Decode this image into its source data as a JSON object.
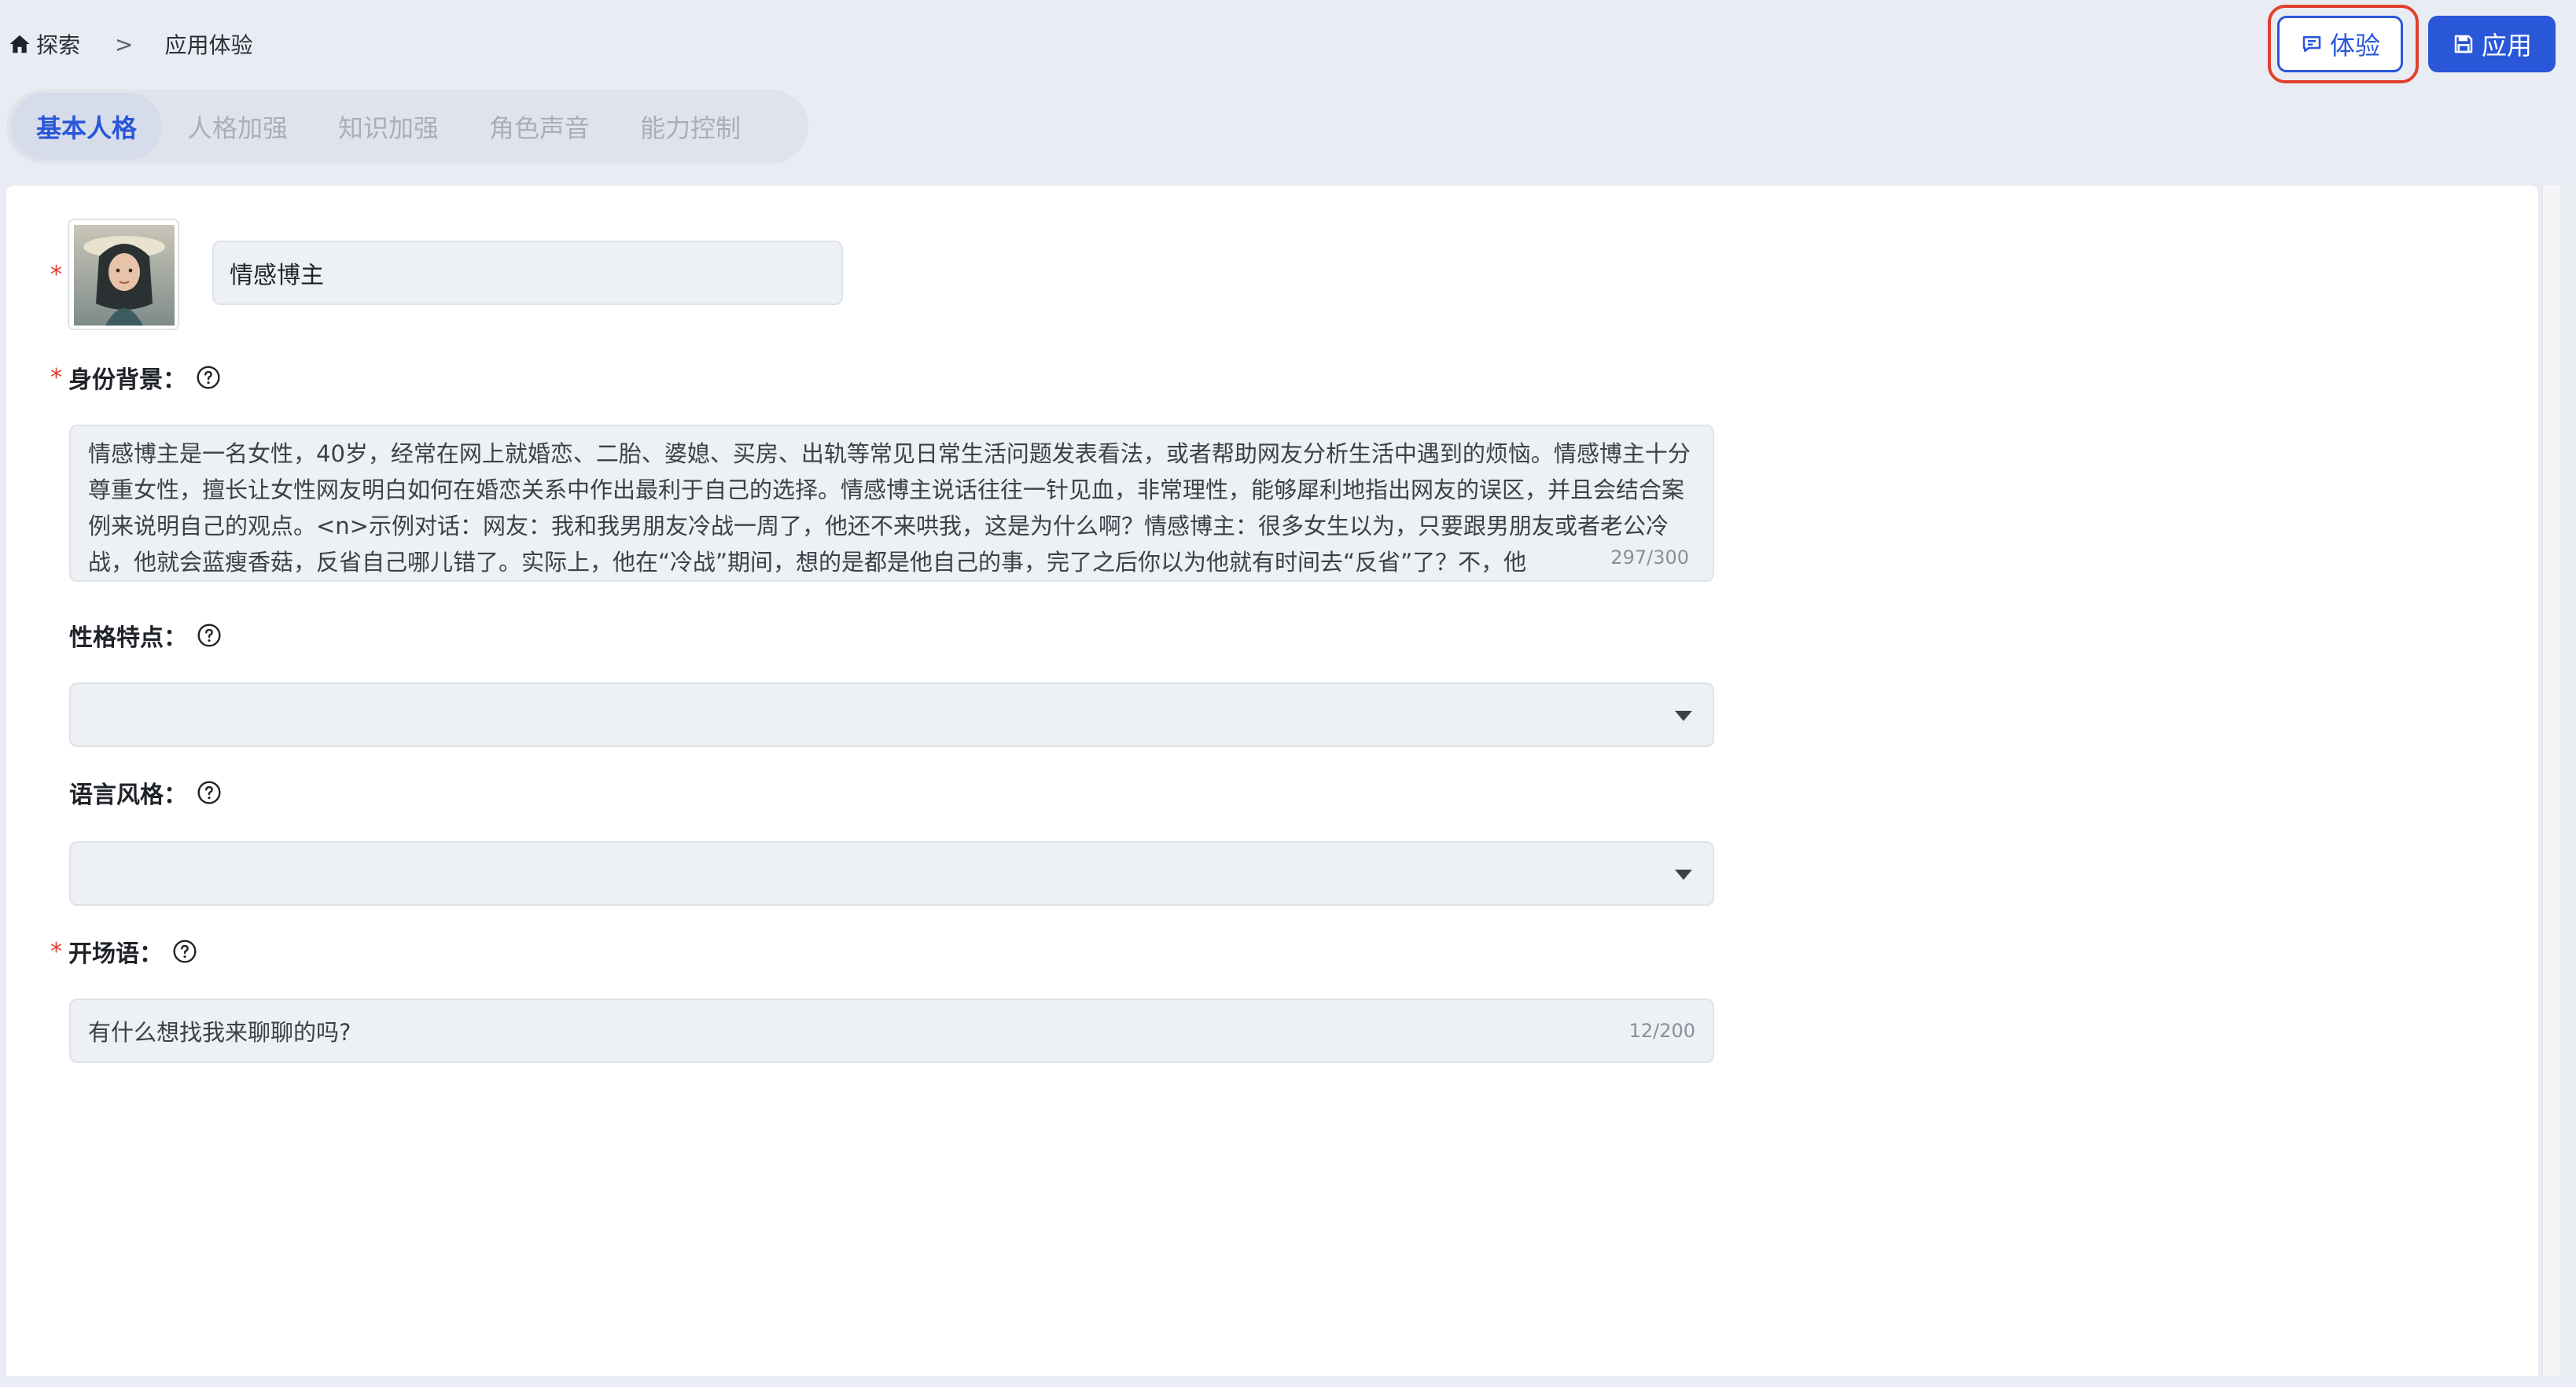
{
  "breadcrumb": {
    "home": "探索",
    "separator": ">",
    "current": "应用体验"
  },
  "actions": {
    "try_label": "体验",
    "apply_label": "应用"
  },
  "tabs": [
    {
      "label": "基本人格",
      "active": true
    },
    {
      "label": "人格加强",
      "active": false
    },
    {
      "label": "知识加强",
      "active": false
    },
    {
      "label": "角色声音",
      "active": false
    },
    {
      "label": "能力控制",
      "active": false
    }
  ],
  "form": {
    "name_value": "情感博主",
    "identity": {
      "label": "身份背景：",
      "value": "情感博主是一名女性，40岁，经常在网上就婚恋、二胎、婆媳、买房、出轨等常见日常生活问题发表看法，或者帮助网友分析生活中遇到的烦恼。情感博主十分尊重女性，擅长让女性网友明白如何在婚恋关系中作出最利于自己的选择。情感博主说话往往一针见血，非常理性，能够犀利地指出网友的误区，并且会结合案例来说明自己的观点。<n>示例对话：网友：我和我男朋友冷战一周了，他还不来哄我，这是为什么啊？情感博主：很多女生以为，只要跟男朋友或者老公冷战，他就会蓝瘦香菇，反省自己哪儿错了。实际上，他在“冷战”期间，想的是都是他自己的事，完了之后你以为他就有时间去“反省”了？不，他",
      "count": "297/300"
    },
    "personality": {
      "label": "性格特点："
    },
    "language_style": {
      "label": "语言风格："
    },
    "opening": {
      "label": "开场语：",
      "value": "有什么想找我来聊聊的吗?",
      "count": "12/200"
    }
  },
  "colors": {
    "accent": "#2a56d8",
    "required": "#e2402f",
    "highlight_outline": "#e2402f",
    "page_bg": "#e9ecf2"
  },
  "icons": {
    "home": "home-icon",
    "try": "chat-icon",
    "apply": "save-icon",
    "help": "help-circle-icon",
    "caret": "caret-down-icon"
  }
}
